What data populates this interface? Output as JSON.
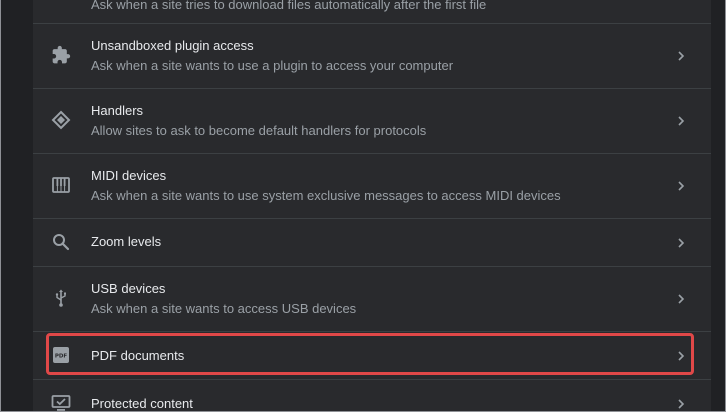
{
  "settings": {
    "items": [
      {
        "title": "",
        "subtitle": "Ask when a site tries to download files automatically after the first file",
        "icon": "download-icon"
      },
      {
        "title": "Unsandboxed plugin access",
        "subtitle": "Ask when a site wants to use a plugin to access your computer",
        "icon": "extension-icon"
      },
      {
        "title": "Handlers",
        "subtitle": "Allow sites to ask to become default handlers for protocols",
        "icon": "handler-diamond-icon"
      },
      {
        "title": "MIDI devices",
        "subtitle": "Ask when a site wants to use system exclusive messages to access MIDI devices",
        "icon": "piano-keys-icon"
      },
      {
        "title": "Zoom levels",
        "subtitle": "",
        "icon": "search-icon"
      },
      {
        "title": "USB devices",
        "subtitle": "Ask when a site wants to access USB devices",
        "icon": "usb-icon"
      },
      {
        "title": "PDF documents",
        "subtitle": "",
        "icon": "pdf-icon",
        "highlighted": true
      },
      {
        "title": "Protected content",
        "subtitle": "",
        "icon": "monitor-check-icon"
      }
    ]
  },
  "colors": {
    "background": "#202124",
    "card": "#292a2d",
    "divider": "#3c4043",
    "title_text": "#e8eaed",
    "subtitle_text": "#9aa0a6",
    "icon": "#9aa0a6",
    "highlight_border": "#e04848"
  }
}
